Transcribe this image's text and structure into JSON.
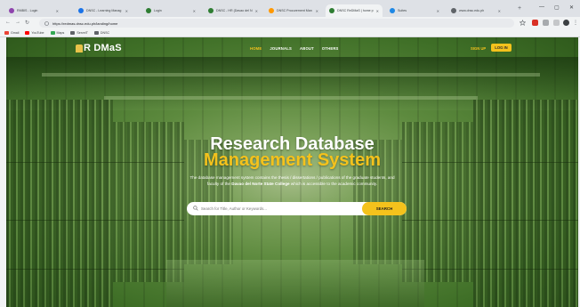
{
  "browser": {
    "tabs": [
      {
        "label": "RMBIS - Login",
        "color": "#8e44ad"
      },
      {
        "label": "DNSC - Learning Manag",
        "color": "#1a73e8"
      },
      {
        "label": "Login",
        "color": "#2e7d32"
      },
      {
        "label": "DNSC - HR (Davao del N",
        "color": "#2e7d32"
      },
      {
        "label": "DNSC Procurement Man",
        "color": "#ff9800"
      },
      {
        "label": "DNSC ReDMaS | home p",
        "color": "#2e7d32"
      },
      {
        "label": "Suites",
        "color": "#1e88e5"
      },
      {
        "label": "www.dnsc.edu.ph",
        "color": "#5f6368"
      }
    ],
    "url": "https://redmas.dnsc.edu.ph/landing/home",
    "bookmarks": [
      {
        "label": "Gmail",
        "color": "#ea4335"
      },
      {
        "label": "YouTube",
        "color": "#ff0000"
      },
      {
        "label": "Maps",
        "color": "#34a853"
      },
      {
        "label": "ServeIT",
        "color": "#5f6368"
      },
      {
        "label": "DNSC",
        "color": "#5f6368"
      }
    ]
  },
  "nav": {
    "logo": "R DMaS",
    "links": [
      "HOME",
      "JOURNALS",
      "ABOUT",
      "OTHERS"
    ],
    "signup": "SIGN UP",
    "login": "LOG IN"
  },
  "hero": {
    "title1": "Research Database",
    "title2": "Management System",
    "desc_pre": "The database management system contains the thesis / dissertations / publications of the graduate students, and faculty of the ",
    "desc_bold": "Davao del Norte State College",
    "desc_post": " which is accessible to the academic community.",
    "search_placeholder": "Search for Title, Author or Keywords...",
    "search_button": "SEARCH"
  }
}
